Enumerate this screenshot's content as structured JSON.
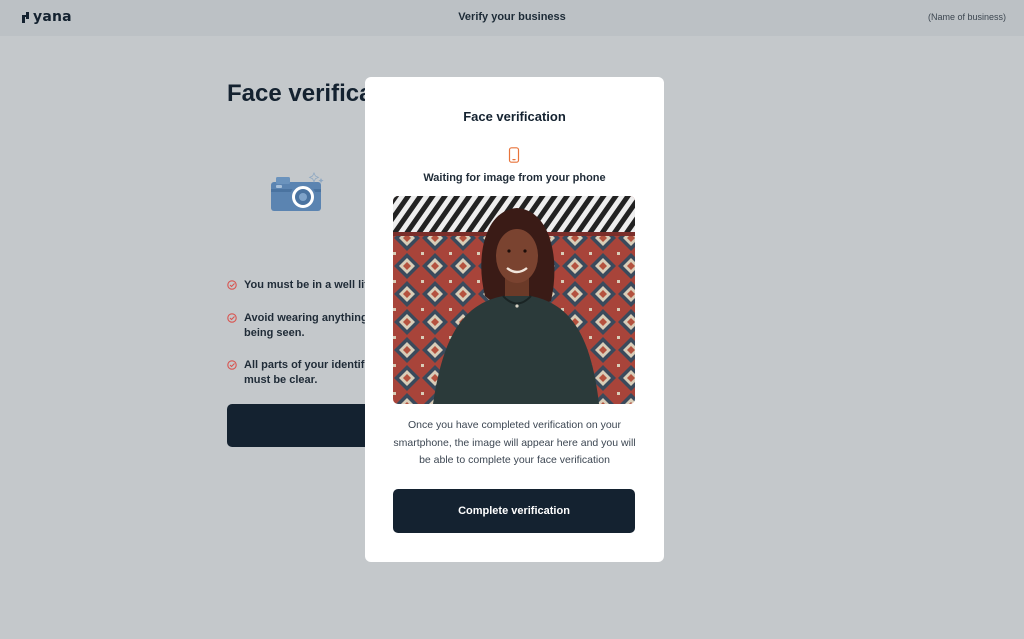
{
  "header": {
    "logo_text": "yana",
    "title": "Verify your business",
    "business_name": "(Name of business)"
  },
  "background": {
    "title": "Face verification",
    "requirements": [
      "You must be in a well lit",
      "Avoid wearing anything being seen.",
      "All parts of your identif must be clear."
    ]
  },
  "modal": {
    "title": "Face verification",
    "status": "Waiting for image from your phone",
    "description": "Once you have completed verification on your smartphone, the image will appear here and you will be able to complete your face verification",
    "button_label": "Complete verification"
  },
  "colors": {
    "primary": "#142230",
    "accent": "#e8743b",
    "check_red": "#d9534f",
    "camera_blue": "#5b84b1"
  },
  "icons": {
    "logo": "yana-logo-icon",
    "phone": "smartphone-icon",
    "check": "check-circle-icon",
    "camera": "camera-illustration"
  }
}
